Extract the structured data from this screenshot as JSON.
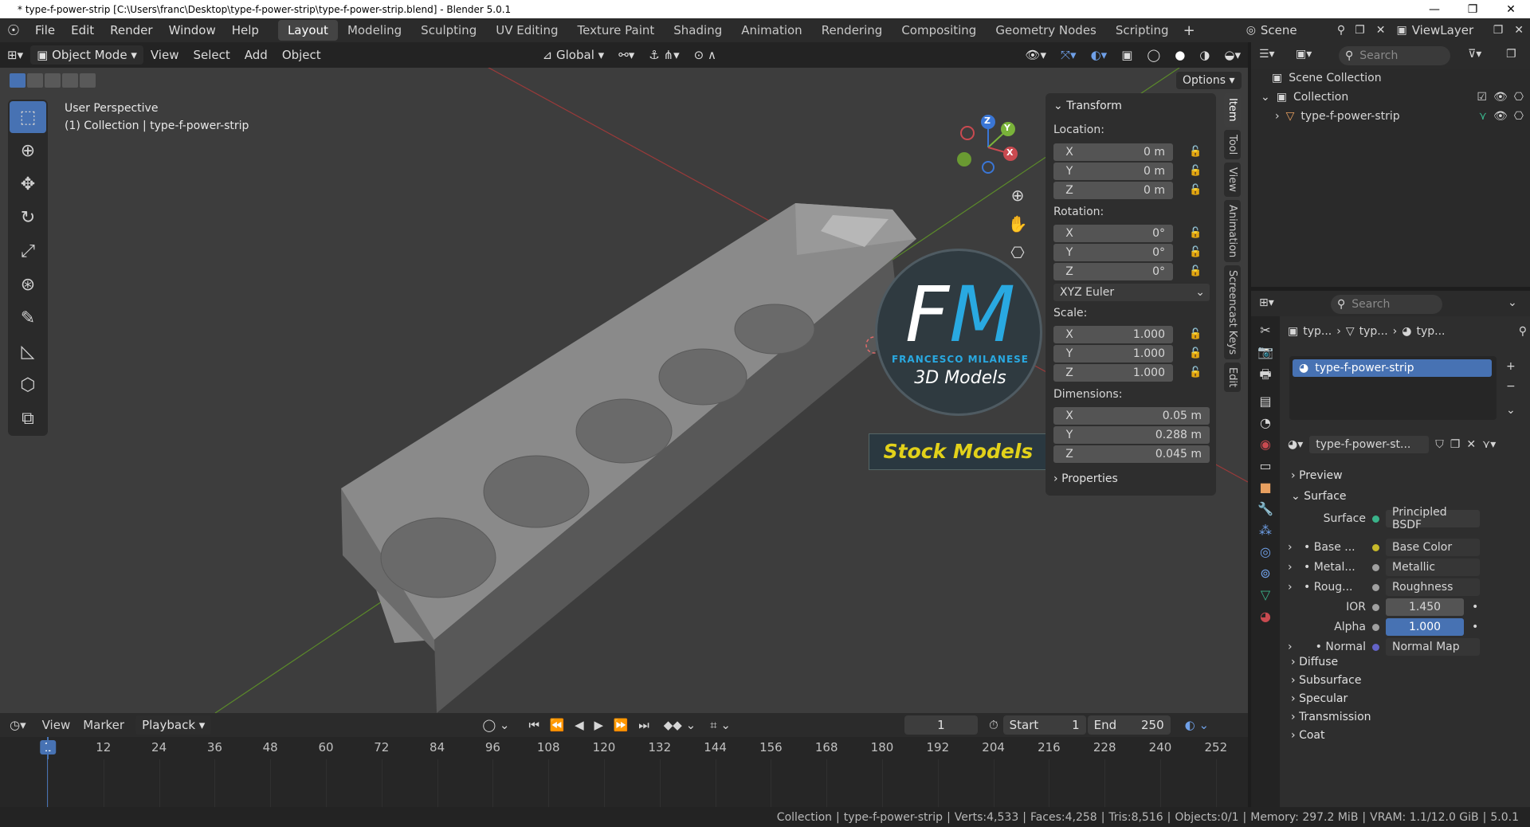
{
  "window": {
    "title": "* type-f-power-strip [C:\\Users\\franc\\Desktop\\type-f-power-strip\\type-f-power-strip.blend] - Blender 5.0.1",
    "controls": [
      "—",
      "❐",
      "✕"
    ]
  },
  "menu": [
    "File",
    "Edit",
    "Render",
    "Window",
    "Help"
  ],
  "workspaces": [
    "Layout",
    "Modeling",
    "Sculpting",
    "UV Editing",
    "Texture Paint",
    "Shading",
    "Animation",
    "Rendering",
    "Compositing",
    "Geometry Nodes",
    "Scripting"
  ],
  "active_workspace": "Layout",
  "scene": "Scene",
  "view_layer": "ViewLayer",
  "viewport_header": {
    "mode": "Object Mode",
    "menus": [
      "View",
      "Select",
      "Add",
      "Object"
    ],
    "orientation": "Global",
    "options": "Options"
  },
  "viewport": {
    "perspective": "User Perspective",
    "collection_info": "(1) Collection | type-f-power-strip",
    "gizmo_axes": [
      "Z",
      "Y",
      "X"
    ],
    "watermark": {
      "initials": "FM",
      "name": "FRANCESCO MILANESE",
      "line": "3D Models",
      "banner": "Stock Models"
    }
  },
  "npanel": {
    "header": "Transform",
    "location_label": "Location:",
    "location": [
      {
        "axis": "X",
        "value": "0 m"
      },
      {
        "axis": "Y",
        "value": "0 m"
      },
      {
        "axis": "Z",
        "value": "0 m"
      }
    ],
    "rotation_label": "Rotation:",
    "rotation": [
      {
        "axis": "X",
        "value": "0°"
      },
      {
        "axis": "Y",
        "value": "0°"
      },
      {
        "axis": "Z",
        "value": "0°"
      }
    ],
    "rotation_mode": "XYZ Euler",
    "scale_label": "Scale:",
    "scale": [
      {
        "axis": "X",
        "value": "1.000"
      },
      {
        "axis": "Y",
        "value": "1.000"
      },
      {
        "axis": "Z",
        "value": "1.000"
      }
    ],
    "dimensions_label": "Dimensions:",
    "dimensions": [
      {
        "axis": "X",
        "value": "0.05 m"
      },
      {
        "axis": "Y",
        "value": "0.288 m"
      },
      {
        "axis": "Z",
        "value": "0.045 m"
      }
    ],
    "properties": "Properties",
    "tabs": [
      "Item",
      "Tool",
      "View",
      "Animation",
      "Screencast Keys",
      "Edit"
    ]
  },
  "outliner": {
    "search_placeholder": "Search",
    "scene_collection": "Scene Collection",
    "collection": "Collection",
    "object": "type-f-power-strip"
  },
  "properties": {
    "search_placeholder": "Search",
    "breadcrumb": [
      "typ...",
      "typ...",
      "typ..."
    ],
    "material_slot": "type-f-power-strip",
    "material_name": "type-f-power-st...",
    "panels": {
      "preview": "Preview",
      "surface": "Surface"
    },
    "surface_label": "Surface",
    "surface_value": "Principled BSDF",
    "inputs": [
      {
        "label": "Base ...",
        "value": "Base Color",
        "color": "#c7b92a"
      },
      {
        "label": "Metal...",
        "value": "Metallic",
        "color": "#a0a0a0"
      },
      {
        "label": "Roug...",
        "value": "Roughness",
        "color": "#a0a0a0"
      }
    ],
    "ior_label": "IOR",
    "ior_value": "1.450",
    "alpha_label": "Alpha",
    "alpha_value": "1.000",
    "normal_label": "Normal",
    "normal_value": "Normal Map",
    "subpanels": [
      "Diffuse",
      "Subsurface",
      "Specular",
      "Transmission",
      "Coat"
    ]
  },
  "timeline": {
    "menus": [
      "View",
      "Marker"
    ],
    "playback": "Playback",
    "current_frame": "1",
    "start_label": "Start",
    "start": "1",
    "end_label": "End",
    "end": "250",
    "ticks": [
      "1",
      "12",
      "24",
      "36",
      "48",
      "60",
      "72",
      "84",
      "96",
      "108",
      "120",
      "132",
      "144",
      "156",
      "168",
      "180",
      "192",
      "204",
      "216",
      "228",
      "240",
      "252"
    ]
  },
  "statusbar": {
    "collection": "Collection",
    "object": "type-f-power-strip",
    "verts": "Verts:4,533",
    "faces": "Faces:4,258",
    "tris": "Tris:8,516",
    "objects": "Objects:0/1",
    "memory": "Memory: 297.2 MiB",
    "vram": "VRAM: 1.1/12.0 GiB",
    "version": "5.0.1"
  },
  "colors": {
    "accent": "#4772b3",
    "x_axis": "#c94a50",
    "y_axis": "#7ab33a",
    "z_axis": "#3a76d6"
  }
}
